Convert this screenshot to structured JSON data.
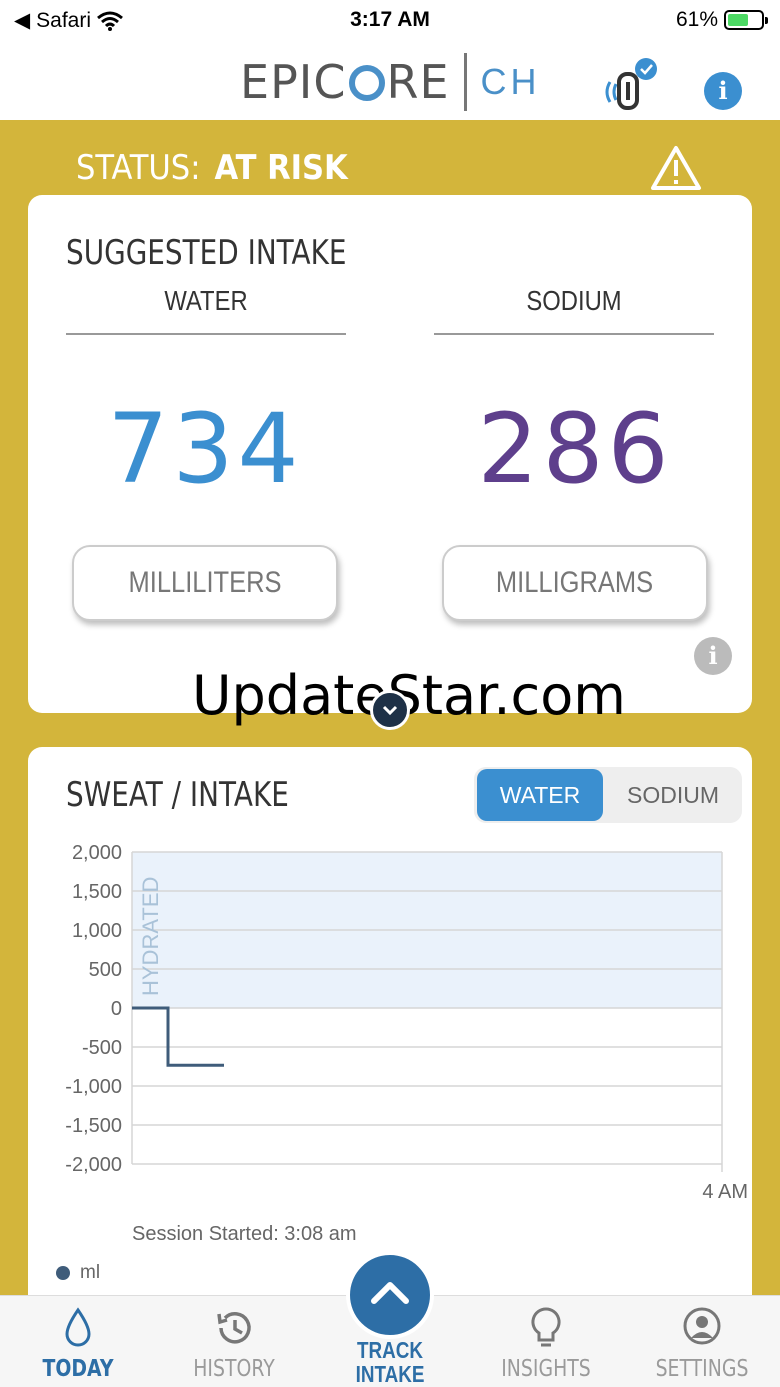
{
  "statusbar": {
    "back_app": "Safari",
    "time": "3:17 AM",
    "battery": "61%",
    "battery_level": 0.61
  },
  "header": {
    "logo_left": "EPIC",
    "logo_right": "RE",
    "logo_sub": "CH"
  },
  "status": {
    "label": "STATUS:",
    "value": "AT RISK"
  },
  "suggested": {
    "title": "SUGGESTED INTAKE",
    "water": {
      "label": "WATER",
      "value": "734",
      "unit": "MILLILITERS",
      "color": "#3b8fd0"
    },
    "sodium": {
      "label": "SODIUM",
      "value": "286",
      "unit": "MILLIGRAMS",
      "color": "#5e3f8c"
    }
  },
  "watermark": "UpdateStar.com",
  "chart_section": {
    "title": "SWEAT / INTAKE",
    "toggle": {
      "water": "WATER",
      "sodium": "SODIUM",
      "selected": "WATER"
    },
    "session": "Session Started: 3:08 am",
    "legend": "ml"
  },
  "chart_data": {
    "type": "line",
    "ylim": [
      -2000,
      2000
    ],
    "yticks": [
      "2,000",
      "1,500",
      "1,000",
      "500",
      "0",
      "-500",
      "-1,000",
      "-1,500",
      "-2,000"
    ],
    "xticks": [
      "4 AM"
    ],
    "band_label": "HYDRATED",
    "band_range": [
      0,
      2000
    ],
    "series": [
      {
        "name": "ml",
        "values": [
          0,
          0,
          -734,
          -734
        ]
      }
    ]
  },
  "tabs": [
    {
      "label": "TODAY",
      "active": true
    },
    {
      "label": "HISTORY",
      "active": false
    },
    {
      "label": "TRACK\nINTAKE",
      "active": false
    },
    {
      "label": "INSIGHTS",
      "active": false
    },
    {
      "label": "SETTINGS",
      "active": false
    }
  ],
  "track": {
    "line1": "TRACK",
    "line2": "INTAKE"
  }
}
